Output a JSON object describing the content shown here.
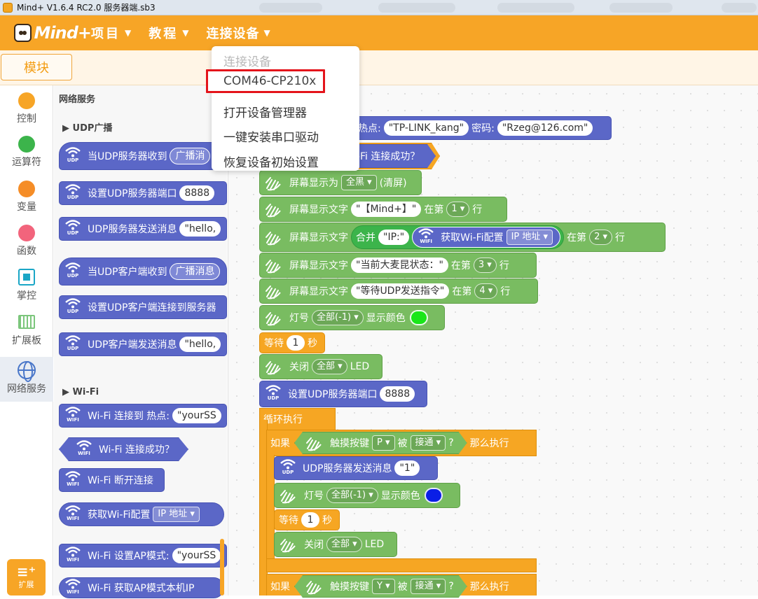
{
  "window": {
    "title": "Mind+ V1.6.4 RC2.0    服务器端.sb3"
  },
  "menubar": {
    "logo_text": "Mind+",
    "items": [
      {
        "label": "项目"
      },
      {
        "label": "教程"
      },
      {
        "label": "连接设备"
      }
    ]
  },
  "device_menu": {
    "items": [
      {
        "label": "连接设备",
        "state": "disabled"
      },
      {
        "label": "COM46-CP210x",
        "state": "highlighted"
      },
      {
        "label": "打开设备管理器"
      },
      {
        "label": "一键安装串口驱动"
      },
      {
        "label": "恢复设备初始设置"
      }
    ],
    "highlight_color": "#e4141b"
  },
  "toolbar": {
    "blocks_tab": "模块"
  },
  "categories": [
    {
      "label": "控制",
      "color": "#f7a526"
    },
    {
      "label": "运算符",
      "color": "#3cb44b"
    },
    {
      "label": "变量",
      "color": "#f58d27"
    },
    {
      "label": "函数",
      "color": "#f2647c"
    },
    {
      "label": "掌控",
      "color": "#1aa6c6"
    },
    {
      "label": "扩展板",
      "color": "#5cb85c"
    },
    {
      "label": "网络服务",
      "color": "#4a77c9"
    }
  ],
  "extension_button": {
    "label": "扩展"
  },
  "flyout": {
    "title": "网络服务",
    "sections": {
      "udp": "UDP广播",
      "wifi": "Wi-Fi"
    },
    "udp_blocks": [
      {
        "text": "当UDP服务器收到",
        "arg": "广播消"
      },
      {
        "text": "设置UDP服务器端口",
        "arg": "8888"
      },
      {
        "text": "UDP服务器发送消息",
        "arg": "\"hello,"
      },
      {
        "text": "当UDP客户端收到",
        "arg": "广播消息"
      },
      {
        "text": "设置UDP客户端连接到服务器"
      },
      {
        "text": "UDP客户端发送消息",
        "arg": "\"hello,"
      }
    ],
    "wifi_blocks": [
      {
        "text": "Wi-Fi 连接到 热点:",
        "arg": "\"yourSS"
      },
      {
        "text": "Wi-Fi 连接成功？"
      },
      {
        "text": "Wi-Fi 断开连接"
      },
      {
        "text": "获取Wi-Fi配置",
        "arg": "IP 地址"
      },
      {
        "text": "Wi-Fi 设置AP模式:",
        "arg": "\"yourSS"
      },
      {
        "text": "Wi-Fi 获取AP模式本机IP"
      }
    ]
  },
  "script": {
    "wifi_connect": {
      "label_hotspot": "热点:",
      "ssid": "\"TP-LINK_kang\"",
      "label_password": "密码:",
      "password": "\"Rzeg@126.com\""
    },
    "wifi_ok_suffix": "i-Fi 连接成功？",
    "fill_screen": {
      "label": "屏幕显示为",
      "value": "全黑",
      "suffix": "(清屏)"
    },
    "show_text_1": {
      "label": "屏幕显示文字",
      "text": "\"【Mind+】\"",
      "row_label": "在第",
      "row": "1",
      "row_suffix": "行"
    },
    "show_text_2": {
      "label": "屏幕显示文字",
      "join": "合并",
      "prefix": "\"IP:\"",
      "get_config": "获取Wi-Fi配置",
      "config": "IP 地址",
      "row_label": "在第",
      "row": "2",
      "row_suffix": "行"
    },
    "show_text_3": {
      "label": "屏幕显示文字",
      "text": "\"当前大麦昆状态：\"",
      "row_label": "在第",
      "row": "3",
      "row_suffix": "行"
    },
    "show_text_4": {
      "label": "屏幕显示文字",
      "text": "\"等待UDP发送指令\"",
      "row_label": "在第",
      "row": "4",
      "row_suffix": "行"
    },
    "led_green": {
      "label": "灯号",
      "target": "全部(-1)",
      "color_label": "显示颜色",
      "color": "#19e619"
    },
    "wait_1": {
      "label": "等待",
      "value": "1",
      "unit": "秒"
    },
    "led_off_1": {
      "label": "关闭",
      "target": "全部",
      "suffix": "LED"
    },
    "udp_port": {
      "label": "设置UDP服务器端口",
      "value": "8888"
    },
    "forever": {
      "label": "循环执行"
    },
    "if_p": {
      "if_label": "如果",
      "touch_label": "触摸按键",
      "key": "P",
      "is_label": "被",
      "state": "接通",
      "q": "?",
      "then_label": "那么执行"
    },
    "udp_send_1": {
      "label": "UDP服务器发送消息",
      "value": "\"1\""
    },
    "led_blue": {
      "label": "灯号",
      "target": "全部(-1)",
      "color_label": "显示颜色",
      "color": "#0a1ee6"
    },
    "wait_2": {
      "label": "等待",
      "value": "1",
      "unit": "秒"
    },
    "led_off_2": {
      "label": "关闭",
      "target": "全部",
      "suffix": "LED"
    },
    "if_y": {
      "if_label": "如果",
      "touch_label": "触摸按键",
      "key": "Y",
      "is_label": "被",
      "state": "接通",
      "q": "?",
      "then_label": "那么执行"
    }
  },
  "wifi_tags": {
    "udp": "UDP",
    "wifi": "WIFI"
  }
}
